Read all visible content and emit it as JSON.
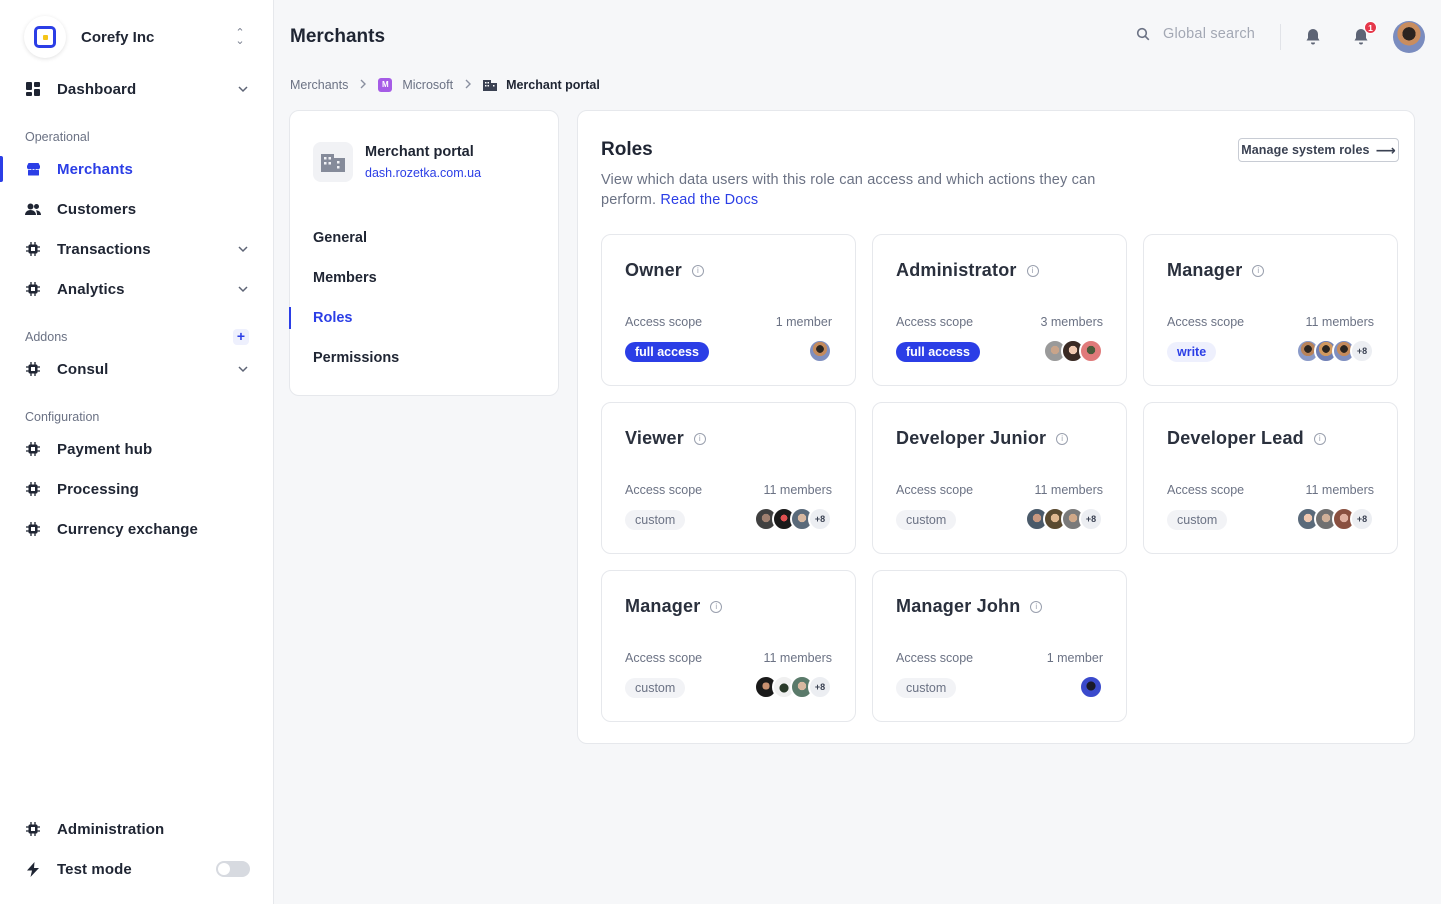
{
  "sidebar": {
    "brand": "Corefy Inc",
    "items": {
      "dashboard": "Dashboard",
      "merchants": "Merchants",
      "customers": "Customers",
      "transactions": "Transactions",
      "analytics": "Analytics",
      "consul": "Consul",
      "payment_hub": "Payment hub",
      "processing": "Processing",
      "currency_exchange": "Currency exchange",
      "administration": "Administration",
      "test_mode": "Test mode"
    },
    "sections": {
      "operational": "Operational",
      "addons": "Addons",
      "configuration": "Configuration"
    },
    "test_mode_enabled": false
  },
  "header": {
    "title": "Merchants",
    "search_placeholder": "Global search",
    "notification_count": "1"
  },
  "breadcrumb": {
    "root": "Merchants",
    "merchant_initial": "M",
    "merchant": "Microsoft",
    "current": "Merchant portal"
  },
  "merchant": {
    "name": "Merchant portal",
    "url": "dash.rozetka.com.ua",
    "nav": {
      "general": "General",
      "members": "Members",
      "roles": "Roles",
      "permissions": "Permissions"
    }
  },
  "roles": {
    "title": "Roles",
    "description": "View which data users with this role can access and which actions they can perform.",
    "docs_link": "Read the Docs",
    "manage_button": "Manage system roles",
    "scope_label": "Access scope",
    "cards": [
      {
        "name": "Owner",
        "members": "1 member",
        "scope": "full access",
        "scope_type": "full",
        "more": ""
      },
      {
        "name": "Administrator",
        "members": "3 members",
        "scope": "full access",
        "scope_type": "full",
        "more": ""
      },
      {
        "name": "Manager",
        "members": "11 members",
        "scope": "write",
        "scope_type": "write",
        "more": "+8"
      },
      {
        "name": "Viewer",
        "members": "11 members",
        "scope": "custom",
        "scope_type": "custom",
        "more": "+8"
      },
      {
        "name": "Developer Junior",
        "members": "11 members",
        "scope": "custom",
        "scope_type": "custom",
        "more": "+8"
      },
      {
        "name": "Developer Lead",
        "members": "11 members",
        "scope": "custom",
        "scope_type": "custom",
        "more": "+8"
      },
      {
        "name": "Manager",
        "members": "11 members",
        "scope": "custom",
        "scope_type": "custom",
        "more": "+8"
      },
      {
        "name": "Manager John",
        "members": "1 member",
        "scope": "custom",
        "scope_type": "custom",
        "more": ""
      }
    ]
  },
  "colors": {
    "accent": "#2b3ee6",
    "notification": "#e5384b",
    "merchant_badge": "#a55ce6"
  }
}
